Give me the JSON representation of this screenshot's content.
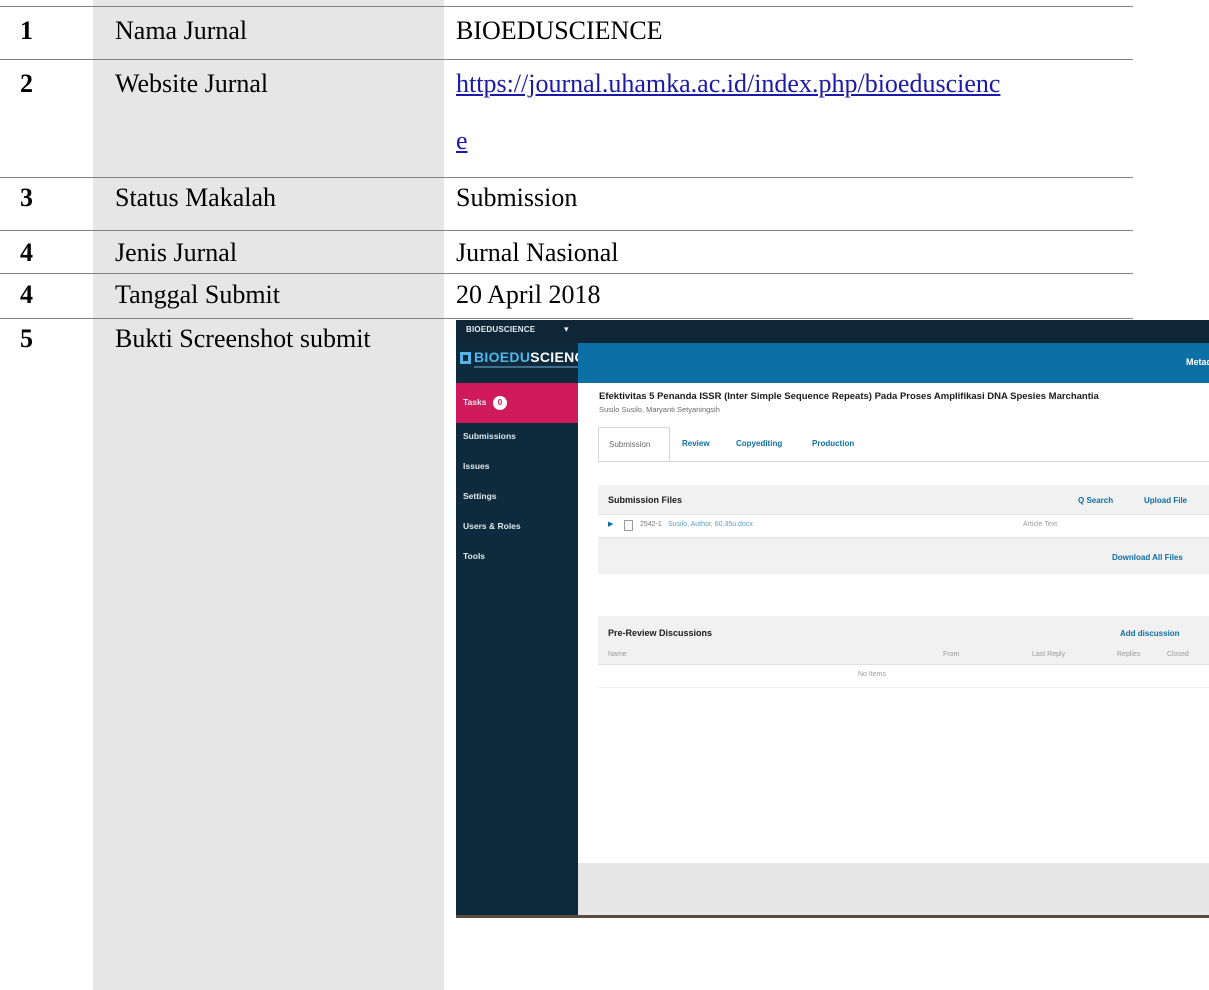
{
  "rows": [
    {
      "no": "1",
      "label": "Nama Jurnal",
      "value": "BIOEDUSCIENCE"
    },
    {
      "no": "2",
      "label": "Website Jurnal",
      "value_line1": "https://journal.uhamka.ac.id/index.php/bioeduscienc",
      "value_line2": "e"
    },
    {
      "no": "3",
      "label": "Status Makalah",
      "value": "Submission"
    },
    {
      "no": "4",
      "label": "Jenis Jurnal",
      "value": "Jurnal Nasional"
    },
    {
      "no": "4",
      "label": "Tanggal Submit",
      "value": "20 April 2018"
    },
    {
      "no": "5",
      "label": "Bukti Screenshot submit"
    }
  ],
  "screenshot": {
    "context_label": "BIOEDUSCIENCE",
    "logo_part1": "BIOEDU",
    "logo_part2": "SCIENCE",
    "header_right": "Metad",
    "sidebar": {
      "tasks_label": "Tasks",
      "tasks_count": "0",
      "items": [
        "Submissions",
        "Issues",
        "Settings",
        "Users & Roles",
        "Tools"
      ]
    },
    "submission_title": "Efektivitas 5 Penanda ISSR (Inter Simple Sequence Repeats) Pada Proses Amplifikasi DNA Spesies Marchantia",
    "authors": "Susilo Susilo, Maryanti Setyaningsih",
    "tabs": [
      "Submission",
      "Review",
      "Copyediting",
      "Production"
    ],
    "files_panel": {
      "title": "Submission Files",
      "search": "Q Search",
      "upload": "Upload File",
      "file_id": "2542-1",
      "file_name": "Susilo, Author, 60.35u.docx",
      "file_type": "Article Text",
      "download_all": "Download All Files"
    },
    "discussions_panel": {
      "title": "Pre-Review Discussions",
      "add": "Add discussion",
      "columns": [
        "Name",
        "From",
        "Last Reply",
        "Replies",
        "Closed"
      ],
      "empty": "No Items"
    }
  },
  "colors": {
    "sidebar": "#0d2b3c",
    "header": "#0c6fa6",
    "active_tab": "#d01b5a",
    "label_column": "#e6e6e6"
  }
}
